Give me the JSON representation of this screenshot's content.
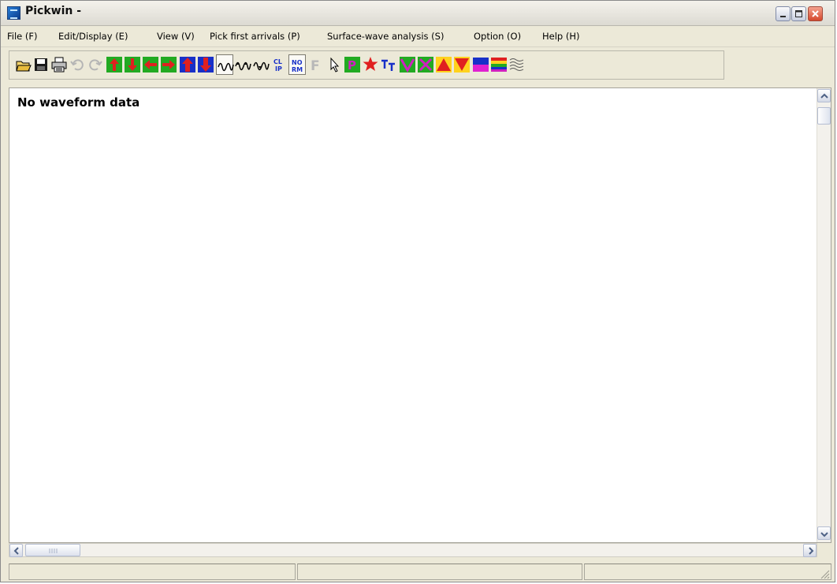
{
  "window": {
    "title": "Pickwin -",
    "controls": [
      "minimize-icon",
      "maximize-icon",
      "close-icon"
    ]
  },
  "menubar": {
    "items": [
      {
        "label": "File (F)"
      },
      {
        "label": "Edit/Display (E)"
      },
      {
        "label": "View (V)"
      },
      {
        "label": "Pick first arrivals (P)"
      },
      {
        "label": "Surface-wave analysis (S)"
      },
      {
        "label": "Option (O)"
      },
      {
        "label": "Help (H)"
      }
    ]
  },
  "toolbar": {
    "buttons": [
      {
        "icon": "open-folder-icon",
        "enabled": true
      },
      {
        "icon": "save-icon",
        "enabled": true
      },
      {
        "icon": "print-icon",
        "enabled": true
      },
      {
        "icon": "undo-icon",
        "enabled": false
      },
      {
        "icon": "redo-icon",
        "enabled": false
      },
      {
        "icon": "arrow-up-green-icon",
        "enabled": true
      },
      {
        "icon": "arrow-down-green-icon",
        "enabled": true
      },
      {
        "icon": "arrow-left-red-icon",
        "enabled": true
      },
      {
        "icon": "arrow-right-red-icon",
        "enabled": true
      },
      {
        "icon": "bold-arrow-up-blue-icon",
        "enabled": true
      },
      {
        "icon": "bold-arrow-down-blue-icon",
        "enabled": true
      },
      {
        "icon": "wiggle-trace-icon",
        "enabled": true,
        "pressed": true
      },
      {
        "icon": "variable-area-trace-icon",
        "enabled": true
      },
      {
        "icon": "wiggle-fill-trace-icon",
        "enabled": true
      },
      {
        "icon": "clip-icon",
        "enabled": true,
        "text": "CL\nIP"
      },
      {
        "icon": "normalize-icon",
        "enabled": true,
        "pressed": true,
        "text": "NO\nRM"
      },
      {
        "icon": "filter-icon",
        "enabled": false,
        "text": "F"
      },
      {
        "icon": "pointer-icon",
        "enabled": true
      },
      {
        "icon": "pick-p-icon",
        "enabled": true,
        "text": "P"
      },
      {
        "icon": "source-star-icon",
        "enabled": true
      },
      {
        "icon": "travel-time-icon",
        "enabled": true,
        "text": "TT"
      },
      {
        "icon": "check-green-icon",
        "enabled": true
      },
      {
        "icon": "cross-magenta-icon",
        "enabled": true
      },
      {
        "icon": "triangle-up-red-icon",
        "enabled": true
      },
      {
        "icon": "triangle-down-red-icon",
        "enabled": true
      },
      {
        "icon": "color-blue-magenta-icon",
        "enabled": true
      },
      {
        "icon": "color-rainbow-icon",
        "enabled": true
      },
      {
        "icon": "wave-gray-icon",
        "enabled": true
      }
    ]
  },
  "document": {
    "message": "No waveform data"
  },
  "scrollbars": {
    "vertical": {
      "up_icon": "chevron-up-icon",
      "down_icon": "chevron-down-icon"
    },
    "horizontal": {
      "left_icon": "chevron-left-icon",
      "right_icon": "chevron-right-icon"
    }
  },
  "statusbar": {
    "panes": [
      "",
      "",
      ""
    ]
  },
  "colors": {
    "window_bg": "#ece9d8",
    "canvas_bg": "#ffffff",
    "green": "#22aa22",
    "red": "#e02020",
    "blue": "#1830c8",
    "magenta": "#d020c0"
  }
}
